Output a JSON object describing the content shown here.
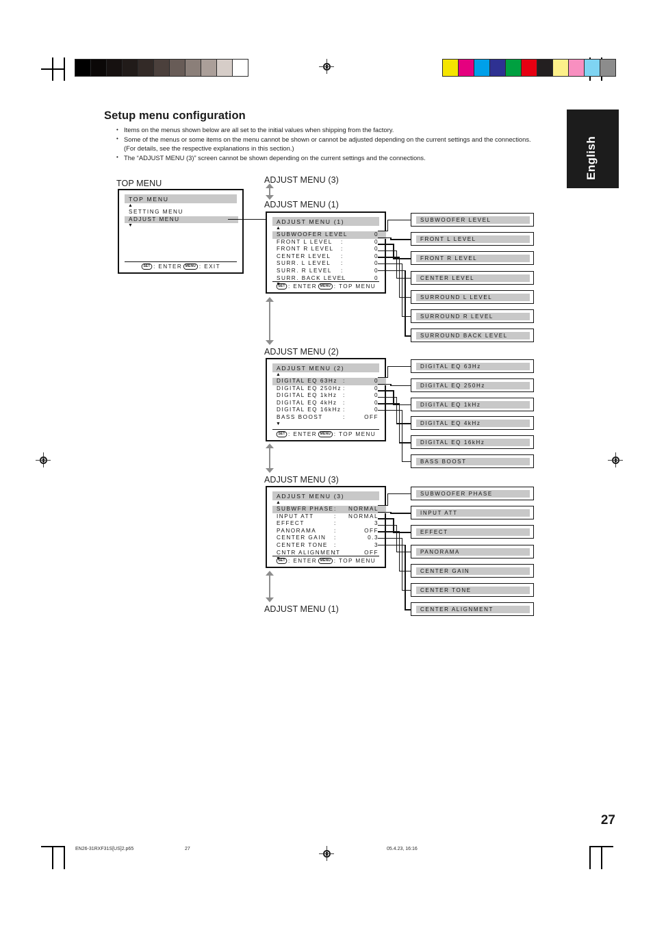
{
  "page": {
    "title": "Setup menu configuration",
    "language_tab": "English",
    "page_number": "27",
    "footer": {
      "filename": "EN26-31RXF31S[US]2.p65",
      "folio": "27",
      "timestamp": "05.4.23, 16:16"
    }
  },
  "intro_bullets": [
    "Items on the menus shown below are all set to the initial values when shipping from the factory.",
    "Some of the menus or some items on the menu cannot be shown or cannot be adjusted depending on the current settings and the connections. (For details, see the respective explanations in this section.)",
    "The “ADJUST MENU (3)” screen cannot be shown depending on the current settings and the connections."
  ],
  "flow_labels": {
    "top_menu": "TOP MENU",
    "adjust3_top": "ADJUST MENU (3)",
    "adjust1": "ADJUST MENU (1)",
    "adjust2": "ADJUST MENU (2)",
    "adjust3": "ADJUST MENU (3)",
    "adjust1_bottom": "ADJUST MENU (1)"
  },
  "keys": {
    "set": "SET",
    "menu": "MENU"
  },
  "top_menu_screen": {
    "title": "TOP  MENU",
    "up_arrow": "▲",
    "down_arrow": "▼",
    "rows": [
      {
        "label": "SETTING  MENU",
        "selected": false
      },
      {
        "label": "ADJUST   MENU",
        "selected": true
      }
    ],
    "footer_enter": ": ENTER",
    "footer_exit": ": EXIT"
  },
  "adjust_menu_1": {
    "title": "ADJUST  MENU  (1)",
    "up_arrow": "▲",
    "down_arrow": "▼",
    "rows": [
      {
        "label": "SUBWOOFER  LEVEL",
        "colon": ":",
        "value": "0",
        "selected": true
      },
      {
        "label": "FRONT  L  LEVEL",
        "colon": ":",
        "value": "0",
        "selected": false
      },
      {
        "label": "FRONT  R  LEVEL",
        "colon": ":",
        "value": "0",
        "selected": false
      },
      {
        "label": "CENTER  LEVEL",
        "colon": ":",
        "value": "0",
        "selected": false
      },
      {
        "label": "SURR.  L  LEVEL",
        "colon": ":",
        "value": "0",
        "selected": false
      },
      {
        "label": "SURR.  R  LEVEL",
        "colon": ":",
        "value": "0",
        "selected": false
      },
      {
        "label": "SURR.  BACK  LEVEL",
        "colon": ":",
        "value": "0",
        "selected": false
      }
    ],
    "footer_enter": ": ENTER",
    "footer_top": ": TOP  MENU",
    "items": [
      "SUBWOOFER  LEVEL",
      "FRONT  L  LEVEL",
      "FRONT  R  LEVEL",
      "CENTER  LEVEL",
      "SURROUND  L  LEVEL",
      "SURROUND  R  LEVEL",
      "SURROUND  BACK  LEVEL"
    ]
  },
  "adjust_menu_2": {
    "title": "ADJUST  MENU  (2)",
    "up_arrow": "▲",
    "down_arrow": "▼",
    "rows": [
      {
        "label": "DIGITAL  EQ    63Hz",
        "colon": ":",
        "value": "0",
        "selected": true
      },
      {
        "label": "DIGITAL  EQ  250Hz",
        "colon": ":",
        "value": "0",
        "selected": false
      },
      {
        "label": "DIGITAL  EQ    1kHz",
        "colon": ":",
        "value": "0",
        "selected": false
      },
      {
        "label": "DIGITAL  EQ    4kHz",
        "colon": ":",
        "value": "0",
        "selected": false
      },
      {
        "label": "DIGITAL  EQ  16kHz",
        "colon": ":",
        "value": "0",
        "selected": false
      },
      {
        "label": "BASS  BOOST",
        "colon": ":",
        "value": "OFF",
        "selected": false
      }
    ],
    "footer_enter": ": ENTER",
    "footer_top": ": TOP  MENU",
    "items": [
      "DIGITAL  EQ  63Hz",
      "DIGITAL  EQ  250Hz",
      "DIGITAL  EQ  1kHz",
      "DIGITAL  EQ  4kHz",
      "DIGITAL  EQ  16kHz",
      "BASS  BOOST"
    ]
  },
  "adjust_menu_3": {
    "title": "ADJUST  MENU  (3)",
    "up_arrow": "▲",
    "down_arrow": "▼",
    "rows": [
      {
        "label": "SUBWFR  PHASE",
        "colon": ":",
        "value": "NORMAL",
        "selected": true
      },
      {
        "label": "INPUT  ATT",
        "colon": ":",
        "value": "NORMAL",
        "selected": false
      },
      {
        "label": "EFFECT",
        "colon": ":",
        "value": "3",
        "selected": false
      },
      {
        "label": "PANORAMA",
        "colon": ":",
        "value": "OFF",
        "selected": false
      },
      {
        "label": "CENTER  GAIN",
        "colon": ":",
        "value": "0.3",
        "selected": false
      },
      {
        "label": "CENTER  TONE",
        "colon": ":",
        "value": "3",
        "selected": false
      },
      {
        "label": "CNTR  ALIGNMENT",
        "colon": ":",
        "value": "OFF",
        "selected": false
      }
    ],
    "footer_enter": ": ENTER",
    "footer_top": ": TOP  MENU",
    "items": [
      "SUBWOOFER  PHASE",
      "INPUT  ATT",
      "EFFECT",
      "PANORAMA",
      "CENTER  GAIN",
      "CENTER  TONE",
      "CENTER  ALIGNMENT"
    ]
  },
  "colors": {
    "osd_highlight": "#c8c8c8",
    "line": "#111111",
    "arrow_gray": "#8d8d8d",
    "tab_bg": "#1c1c1c"
  },
  "gray_bar_swatches": [
    "#000000",
    "#0b0807",
    "#161110",
    "#211b19",
    "#332a27",
    "#4b403c",
    "#685c57",
    "#8b7f79",
    "#ab9f99",
    "#d6cdc8",
    "#ffffff"
  ],
  "color_bar_swatches": [
    "#f5e500",
    "#e5007f",
    "#00a0e9",
    "#2e3192",
    "#00a040",
    "#e60012",
    "#231f20",
    "#fdf08a",
    "#f88fc0",
    "#7fd4f2",
    "#8c8c8c"
  ]
}
